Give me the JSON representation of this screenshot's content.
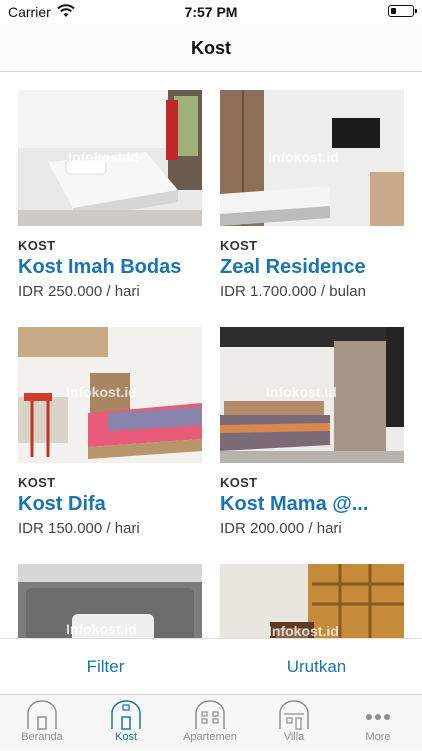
{
  "status_bar": {
    "carrier": "Carrier",
    "time": "7:57 PM",
    "battery_level": 0.3
  },
  "nav": {
    "title": "Kost"
  },
  "listings": [
    {
      "category": "KOST",
      "name": "Kost Imah Bodas",
      "price": "IDR 250.000 / hari",
      "watermark": "Infokost.id"
    },
    {
      "category": "KOST",
      "name": "Zeal Residence",
      "price": "IDR 1.700.000 / bulan",
      "watermark": "Infokost.id"
    },
    {
      "category": "KOST",
      "name": "Kost Difa",
      "price": "IDR 150.000 / hari",
      "watermark": "Infokost.id"
    },
    {
      "category": "KOST",
      "name": "Kost Mama @...",
      "price": "IDR 200.000 / hari",
      "watermark": "Infokost.id"
    },
    {
      "category": "",
      "name": "",
      "price": "",
      "watermark": "Infokost.id"
    },
    {
      "category": "",
      "name": "",
      "price": "",
      "watermark": "Infokost.id"
    }
  ],
  "actions": {
    "filter": "Filter",
    "sort": "Urutkan"
  },
  "tabs": [
    {
      "label": "Beranda",
      "icon": "home-icon",
      "active": false
    },
    {
      "label": "Kost",
      "icon": "house-icon",
      "active": true
    },
    {
      "label": "Apartemen",
      "icon": "apartment-icon",
      "active": false
    },
    {
      "label": "Villa",
      "icon": "villa-icon",
      "active": false
    },
    {
      "label": "More",
      "icon": "more-icon",
      "active": false
    }
  ],
  "colors": {
    "accent": "#1a73b5",
    "inactive": "#8e8e8e"
  }
}
